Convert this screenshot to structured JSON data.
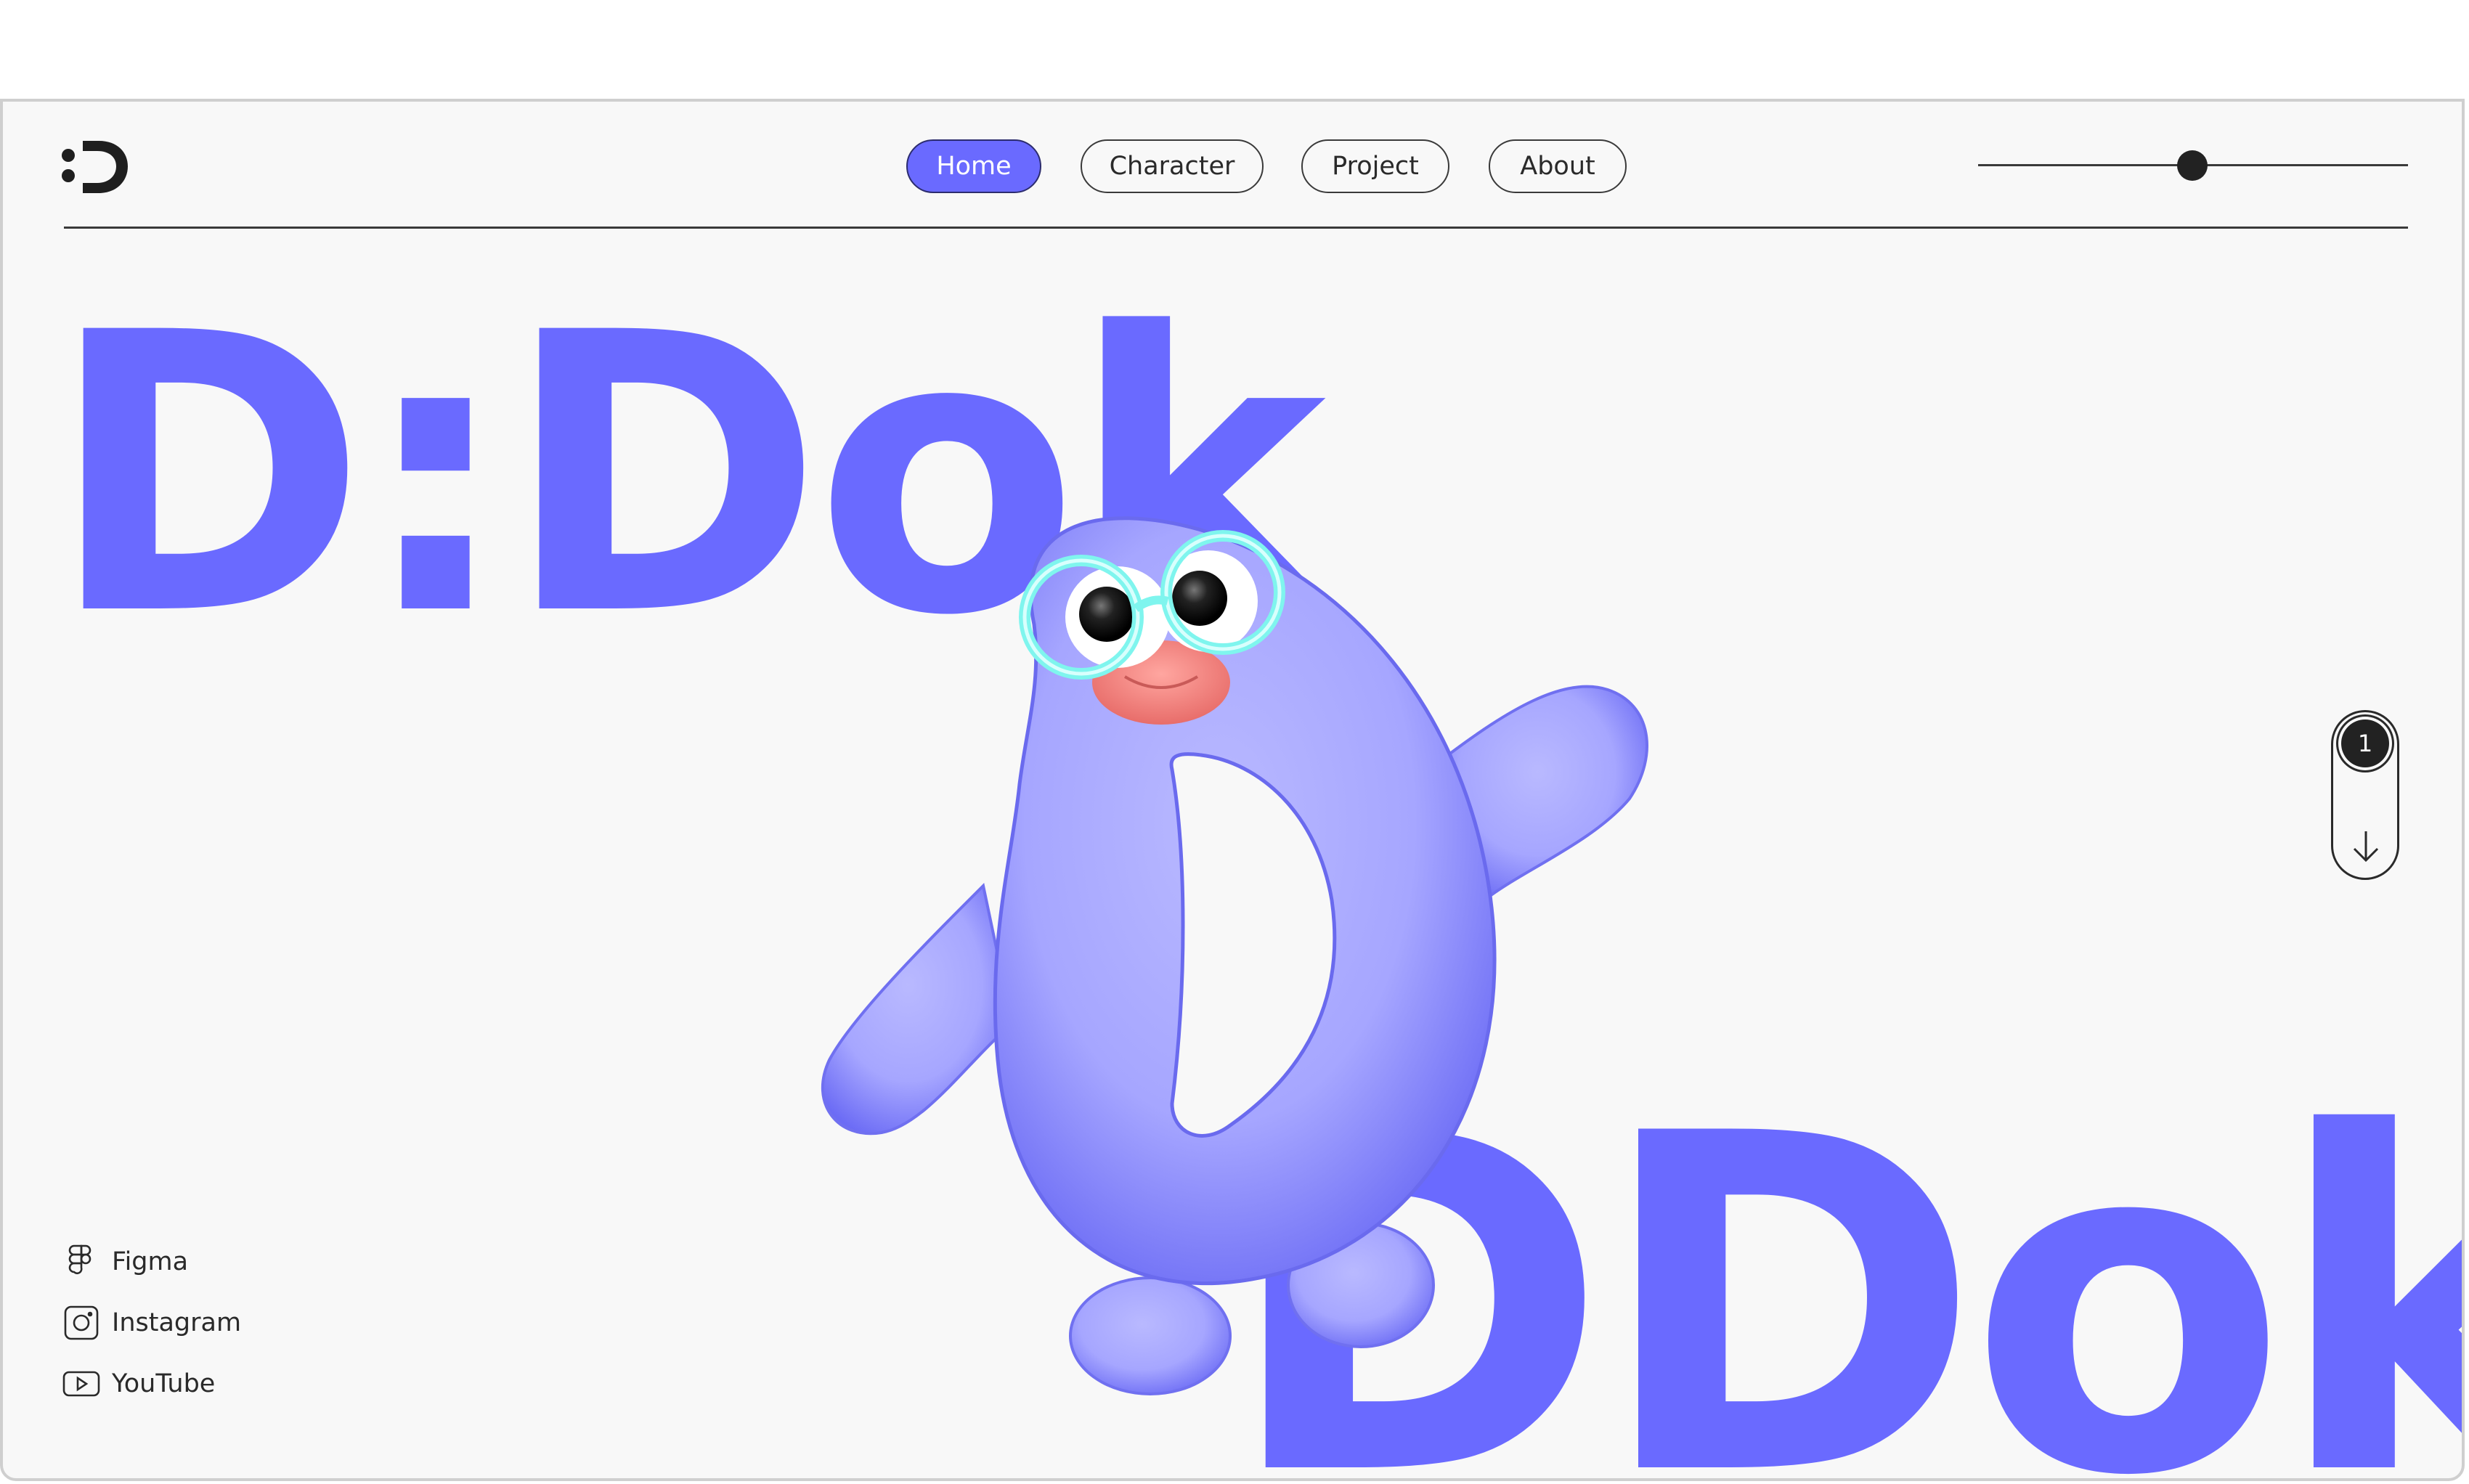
{
  "nav": {
    "items": [
      {
        "label": "Home",
        "active": true
      },
      {
        "label": "Character",
        "active": false
      },
      {
        "label": "Project",
        "active": false
      },
      {
        "label": "About",
        "active": false
      }
    ]
  },
  "hero": {
    "title_top": "D:Dok",
    "title_bottom": "DDok"
  },
  "pager": {
    "current": "1"
  },
  "social": [
    {
      "label": "Figma",
      "icon": "figma-icon"
    },
    {
      "label": "Instagram",
      "icon": "instagram-icon"
    },
    {
      "label": "YouTube",
      "icon": "youtube-icon"
    }
  ],
  "colors": {
    "accent": "#6a6aff",
    "character_body": "#a9a9ff",
    "glasses": "#7ff5ee",
    "mouth": "#f58a86",
    "dark": "#222222",
    "background": "#f8f8f8"
  }
}
